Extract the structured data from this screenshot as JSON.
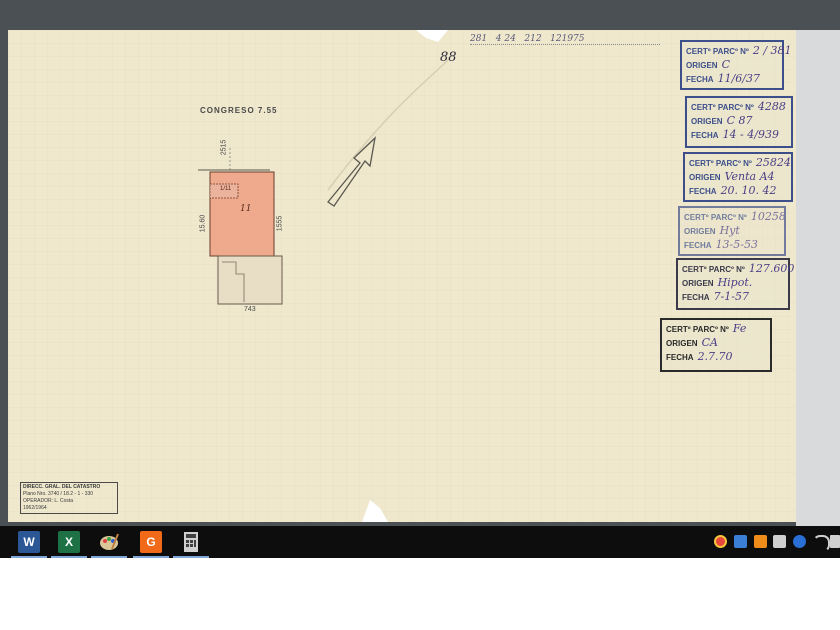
{
  "document": {
    "street_label": "CONGRESO 7.55",
    "header_handwriting": "281   4 24   212   121975",
    "page_number": "88",
    "dim_front": "2515",
    "dim_left": "15.60",
    "dim_right": "1555",
    "dim_bottom": "743",
    "parcel_label": "11",
    "small_parcel_label": "1/11",
    "footer_stamp": {
      "line1": "DIRECC. GRAL. DEL CATASTRO",
      "line2": "Plano Nro. 3740 / 18.2 - 1 - 330",
      "line3": "OPERADOR: L. Costa",
      "line4": "1962/1964"
    }
  },
  "stamps": [
    {
      "cert_label": "CERTº PARCº Nº",
      "cert_value": "2 / 381",
      "origen_label": "ORIGEN",
      "origen_value": "C",
      "fecha_label": "FECHA",
      "fecha_value": "11/6/37"
    },
    {
      "cert_label": "CERTº PARCº Nº",
      "cert_value": "4288",
      "origen_label": "ORIGEN",
      "origen_value": "C   87",
      "fecha_label": "FECHA",
      "fecha_value": "14 - 4/939"
    },
    {
      "cert_label": "CERTº PARCº Nº",
      "cert_value": "25824",
      "origen_label": "ORIGEN",
      "origen_value": "Venta A4",
      "fecha_label": "FECHA",
      "fecha_value": "20. 10. 42"
    },
    {
      "cert_label": "CERTº PARCº Nº",
      "cert_value": "10258",
      "origen_label": "ORIGEN",
      "origen_value": "Hyt",
      "fecha_label": "FECHA",
      "fecha_value": "13-5-53"
    },
    {
      "cert_label": "CERTº PARCº Nº",
      "cert_value": "127.600",
      "origen_label": "ORIGEN",
      "origen_value": "Hipot.",
      "fecha_label": "FECHA",
      "fecha_value": "7-1-57"
    },
    {
      "cert_label": "CERTº PARCº Nº",
      "cert_value": "Fe",
      "origen_label": "ORIGEN",
      "origen_value": "CA",
      "fecha_label": "FECHA",
      "fecha_value": "2.7.70"
    }
  ],
  "taskbar": {
    "apps": [
      {
        "name": "word",
        "letter": "W",
        "color": "#2b5797"
      },
      {
        "name": "excel",
        "letter": "X",
        "color": "#1e7145"
      },
      {
        "name": "paint",
        "letter": "",
        "color": "#0d0d0d"
      },
      {
        "name": "acrobat",
        "letter": "G",
        "color": "#f06a19"
      },
      {
        "name": "calculator",
        "letter": "",
        "color": "#2d2d2d"
      }
    ],
    "tray_colors": {
      "chrome": "#e8453c",
      "other": "#3b7ed6",
      "orange": "#f08c1a"
    }
  }
}
